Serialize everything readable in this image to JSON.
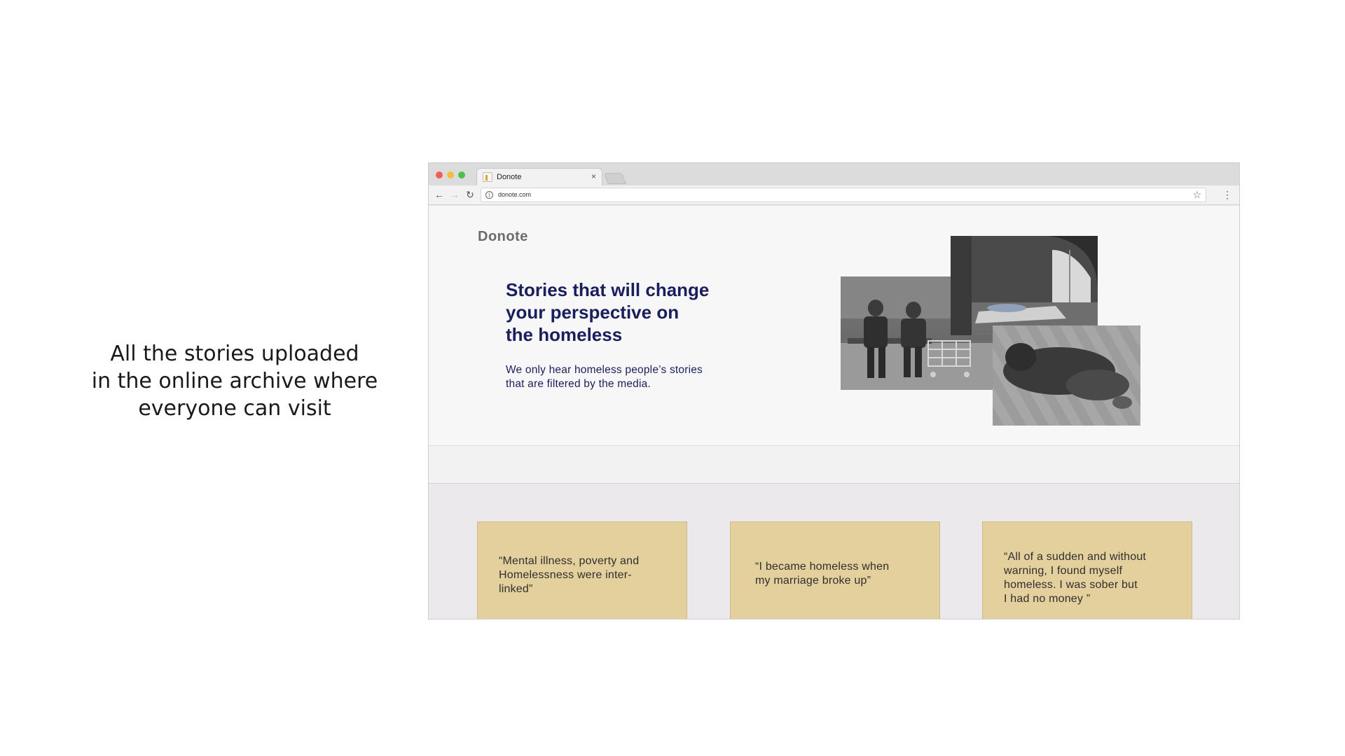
{
  "caption": {
    "lines": [
      "All the stories uploaded",
      "in the online archive where",
      "everyone can visit"
    ]
  },
  "browser": {
    "tab_title": "Donote",
    "tab_close": "×",
    "url": "donote.com",
    "site": {
      "logo": "Donote",
      "headline_lines": [
        "Stories that will change",
        "your perspective on",
        "the homeless"
      ],
      "subtext_lines": [
        "We only hear homeless people’s stories",
        "that are filtered by the media."
      ],
      "cards": [
        {
          "lines": [
            "“Mental illness, poverty and",
            "Homelessness were inter-",
            "linked”"
          ]
        },
        {
          "lines": [
            "“I became homeless when",
            "my marriage broke up”"
          ]
        },
        {
          "lines": [
            "“All of a sudden and without",
            "warning, I found myself",
            "homeless. I was sober but",
            "I had no money ”"
          ]
        }
      ]
    }
  },
  "colors": {
    "headline": "#1b1e5c",
    "card_bg": "#e4d09d",
    "page_bg": "#ebe9eb"
  },
  "icons": [
    "back-arrow-icon",
    "forward-arrow-icon",
    "reload-icon",
    "info-icon",
    "star-icon",
    "kebab-menu-icon",
    "close-icon"
  ]
}
